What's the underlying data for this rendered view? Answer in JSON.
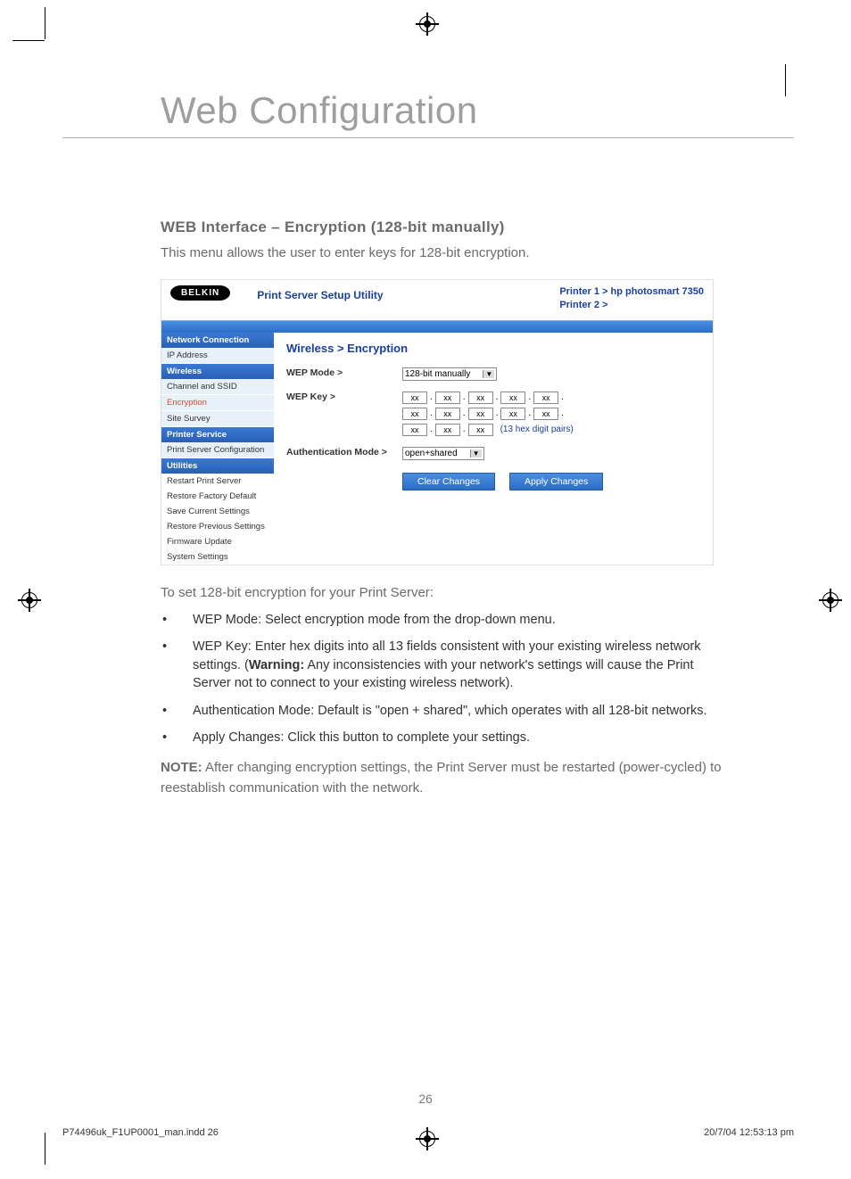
{
  "chapter_title": "Web Configuration",
  "subhead": "WEB Interface – Encryption (128-bit manually)",
  "lead": "This menu allows the user to enter keys for 128-bit encryption.",
  "screenshot": {
    "logo": "BELKIN",
    "utility_title": "Print Server Setup Utility",
    "printer1": "Printer 1 > hp photosmart 7350",
    "printer2": "Printer 2 >",
    "sidebar": {
      "groups": [
        {
          "head": "Network Connection",
          "items": [
            "IP Address"
          ]
        },
        {
          "head": "Wireless",
          "items": [
            "Channel and SSID",
            "Encryption",
            "Site Survey"
          ]
        },
        {
          "head": "Printer Service",
          "items": [
            "Print Server Configuration"
          ]
        },
        {
          "head": "Utilities",
          "items": [
            "Restart Print Server",
            "Restore Factory Default",
            "Save Current Settings",
            "Restore Previous Settings",
            "Firmware Update",
            "System Settings"
          ]
        }
      ],
      "active": "Encryption"
    },
    "crumb": "Wireless > Encryption",
    "wep_mode_label": "WEP Mode >",
    "wep_mode_value": "128-bit manually",
    "wep_key_label": "WEP Key >",
    "hex_placeholder": "xx",
    "hex_note": "(13 hex digit pairs)",
    "auth_label": "Authentication Mode >",
    "auth_value": "open+shared",
    "btn_clear": "Clear Changes",
    "btn_apply": "Apply Changes"
  },
  "instructions_lead": "To set 128-bit encryption for your Print Server:",
  "bullets": [
    "WEP Mode: Select encryption mode from the drop-down menu.",
    "WEP Key: Enter hex digits into all 13 fields consistent with your existing wireless network settings. (",
    "Authentication Mode: Default is \"open + shared\", which operates with all 128-bit networks.",
    "Apply Changes: Click this button to complete your settings."
  ],
  "warning_label": "Warning:",
  "warning_tail": " Any inconsistencies with your network's settings will cause the Print Server not to connect to your existing wireless network).",
  "note_label": "NOTE:",
  "note_text": " After changing encryption settings, the Print Server must be restarted (power-cycled) to reestablish communication with the network.",
  "page_number": "26",
  "footer_left": "P74496uk_F1UP0001_man.indd   26",
  "footer_right": "20/7/04   12:53:13 pm"
}
